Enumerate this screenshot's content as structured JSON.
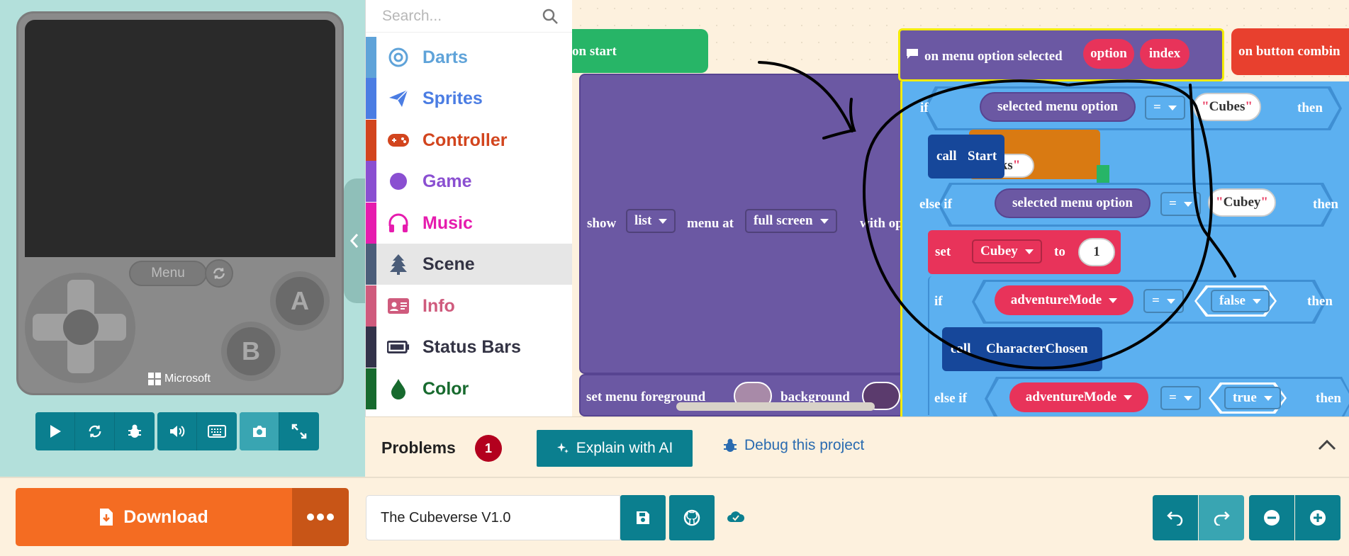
{
  "simulator": {
    "menu_label": "Menu",
    "button_a": "A",
    "button_b": "B",
    "brand": "Microsoft"
  },
  "toolbox": {
    "search_placeholder": "Search...",
    "categories": [
      {
        "label": "Darts",
        "color": "#5fa3d9",
        "icon": "target-icon"
      },
      {
        "label": "Sprites",
        "color": "#4b7de3",
        "icon": "paper-plane-icon"
      },
      {
        "label": "Controller",
        "color": "#d2451e",
        "icon": "gamepad-icon"
      },
      {
        "label": "Game",
        "color": "#8a4fd1",
        "icon": "circle-icon"
      },
      {
        "label": "Music",
        "color": "#e61cae",
        "icon": "headphones-icon"
      },
      {
        "label": "Scene",
        "color": "#4b5d79",
        "icon": "tree-icon"
      },
      {
        "label": "Info",
        "color": "#cf5b7d",
        "icon": "id-card-icon"
      },
      {
        "label": "Status Bars",
        "color": "#33334a",
        "icon": "battery-icon"
      },
      {
        "label": "Color",
        "color": "#176a2e",
        "icon": "droplet-icon"
      }
    ]
  },
  "workspace": {
    "on_start": "on start",
    "show_text": "show",
    "list_dropdown": "list",
    "menu_at_text": "menu at",
    "full_screen_dropdown": "full screen",
    "with_op_text": "with op",
    "set_menu_fg": "set menu foreground",
    "background_text": "background",
    "event_label": "on menu option selected",
    "option_param": "option",
    "index_param": "index",
    "on_button_combo": "on button combin",
    "if_text": "if",
    "else_if_text": "else if",
    "then_text": "then",
    "selected_menu_option": "selected menu option",
    "equals_op": "=",
    "cubes_value": "Cubes",
    "cubey_value": "Cubey",
    "call_text": "call",
    "start_fn": "Start",
    "ks_fragment": "ks",
    "set_text": "set",
    "cubey_var": "Cubey",
    "to_text": "to",
    "one_value": "1",
    "adventure_mode": "adventureMode",
    "false_value": "false",
    "true_value": "true",
    "character_chosen_fn": "CharacterChosen"
  },
  "problems": {
    "title": "Problems",
    "count": "1",
    "explain_label": "Explain with AI",
    "debug_label": "Debug this project"
  },
  "bottom": {
    "download_label": "Download",
    "project_name": "The Cubeverse V1.0"
  }
}
